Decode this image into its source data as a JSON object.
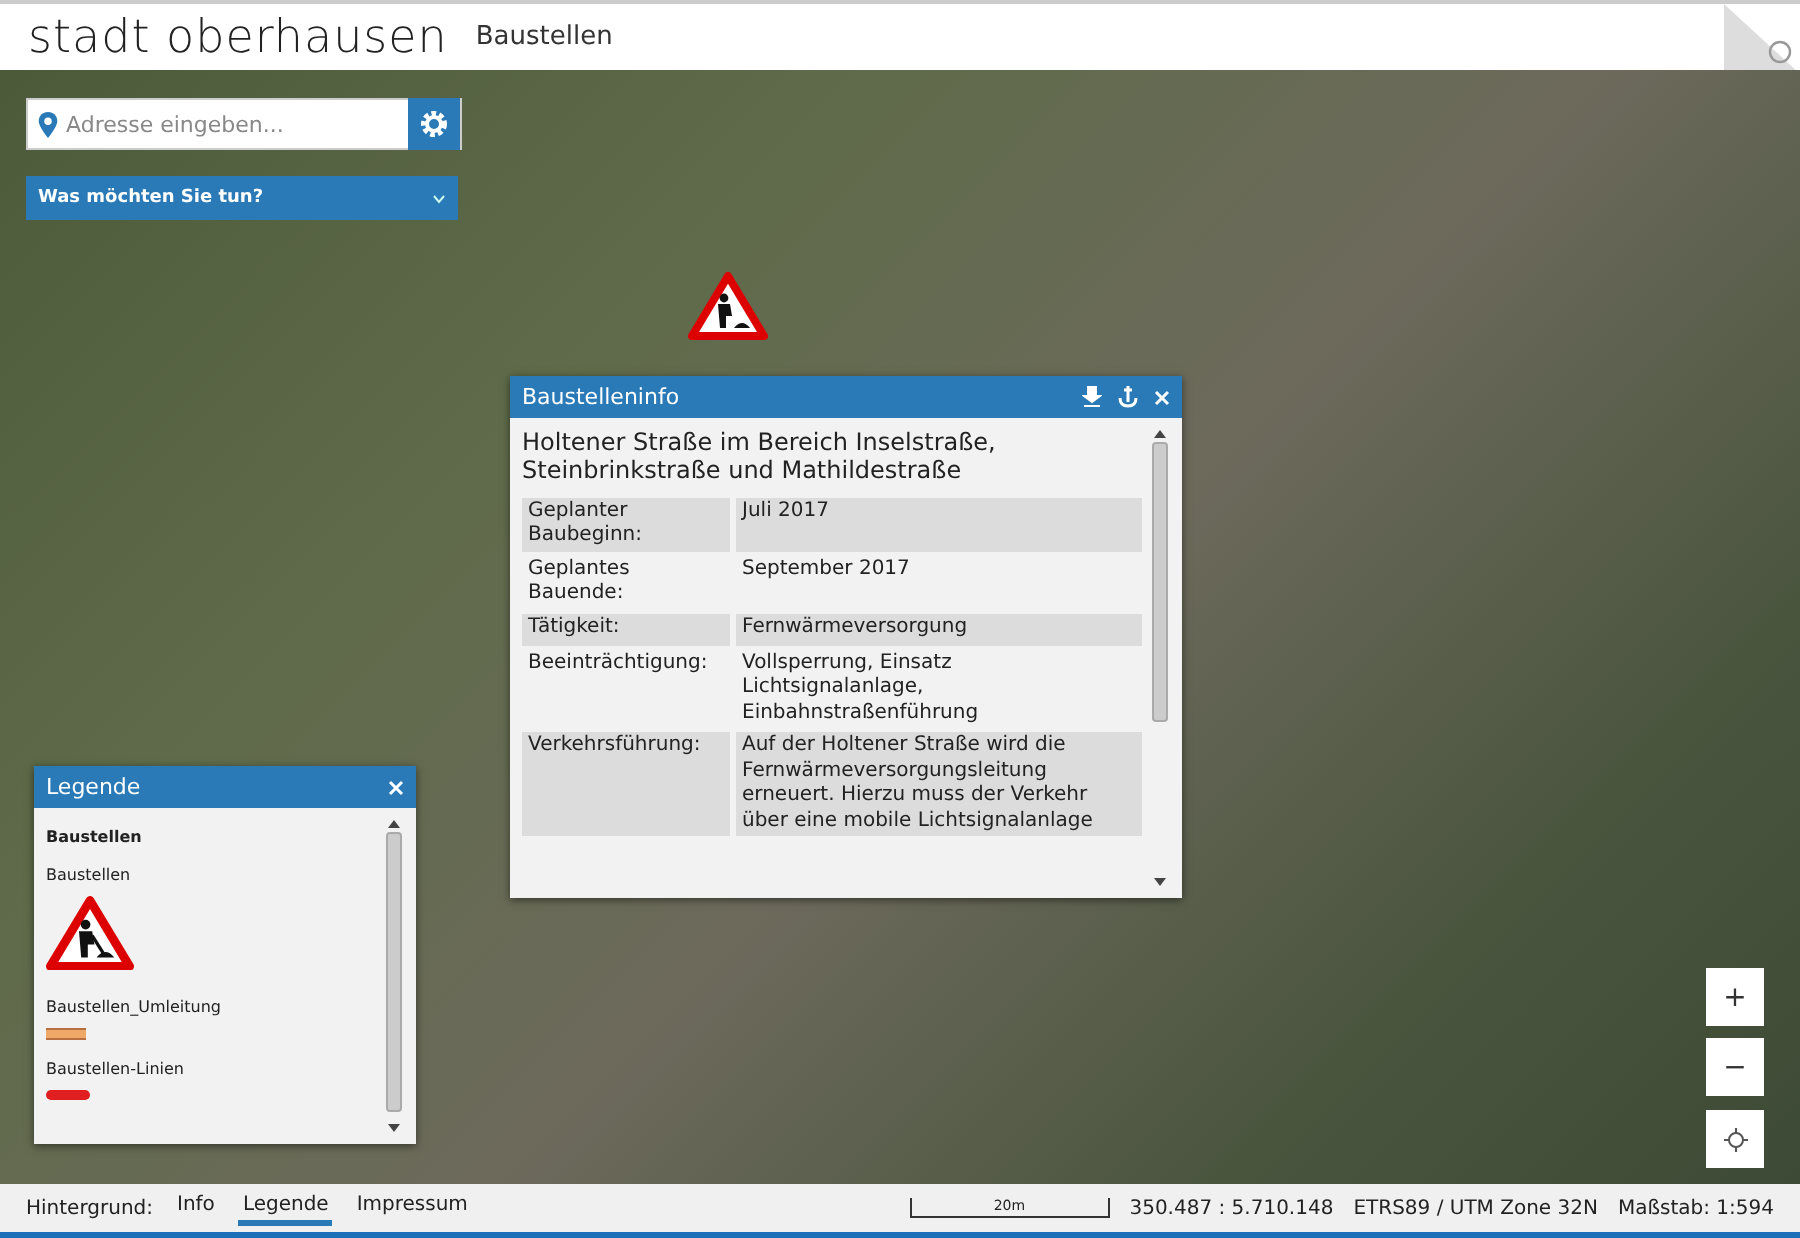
{
  "header": {
    "logo": "stadt oberhausen",
    "title": "Baustellen"
  },
  "search": {
    "placeholder": "Adresse eingeben..."
  },
  "menu": {
    "label": "Was möchten Sie tun?",
    "expanded": false
  },
  "info_panel": {
    "title": "Baustelleninfo",
    "heading": "Holtener Straße im Bereich Inselstraße, Steinbrinkstraße und Mathildestraße",
    "rows": [
      {
        "label": "Geplanter Baubeginn:",
        "value": "Juli 2017",
        "shaded": true
      },
      {
        "label": "Geplantes Bauende:",
        "value": "September 2017",
        "shaded": false
      },
      {
        "label": "Tätigkeit:",
        "value": "Fernwärmeversorgung",
        "shaded": true
      },
      {
        "label": "Beeinträchtigung:",
        "value": "Vollsperrung, Einsatz Lichtsignalanlage, Einbahnstraßenführung",
        "shaded": false
      },
      {
        "label": "Verkehrsführung:",
        "value": "Auf der Holtener Straße wird die Fernwärmeversorgungsleitung erneuert. Hierzu muss der Verkehr über eine mobile Lichtsignalanlage",
        "shaded": true
      }
    ]
  },
  "legend_panel": {
    "title": "Legende",
    "group": "Baustellen",
    "items": [
      {
        "label": "Baustellen",
        "kind": "sign"
      },
      {
        "label": "Baustellen_Umleitung",
        "kind": "band",
        "color": "#f0a868"
      },
      {
        "label": "Baustellen-Linien",
        "kind": "line",
        "color": "#e02020"
      }
    ]
  },
  "map_controls": [
    "+",
    "−"
  ],
  "status_bar": {
    "label": "Hintergrund:",
    "links": [
      {
        "label": "Info",
        "selected": false
      },
      {
        "label": "Legende",
        "selected": true
      },
      {
        "label": "Impressum",
        "selected": false
      }
    ],
    "scale": "20m",
    "coordinates": "350.487 : 5.710.148",
    "projection": "ETRS89 / UTM Zone 32N",
    "ratio": "Maßstab: 1:594"
  }
}
